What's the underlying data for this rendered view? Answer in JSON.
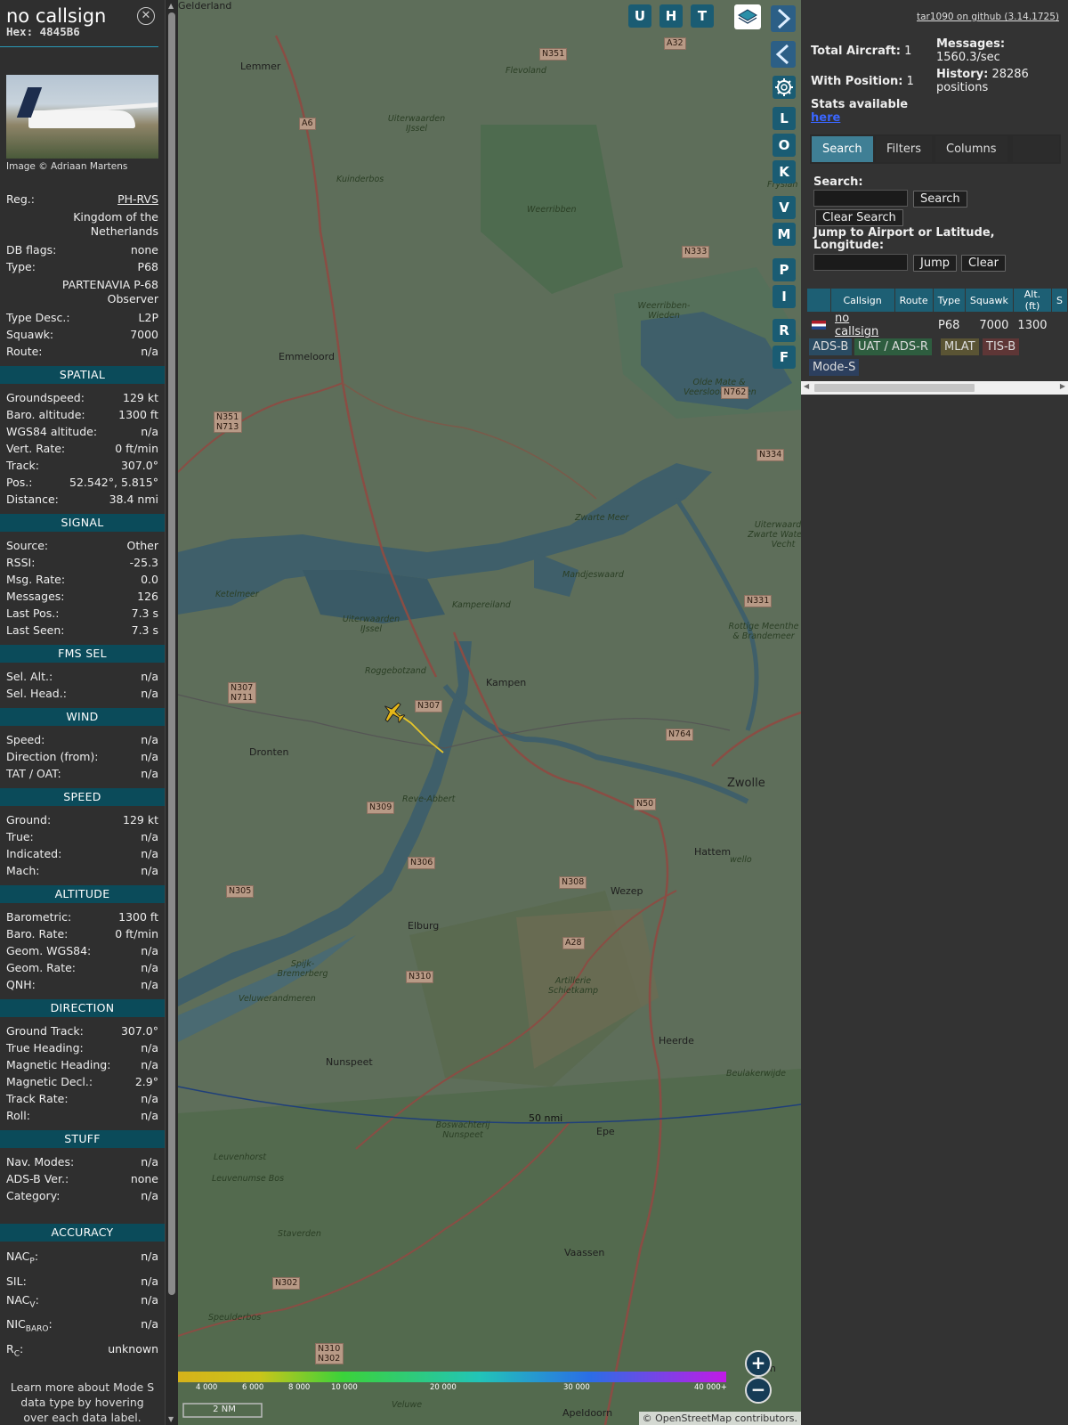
{
  "info": {
    "callsign": "no callsign",
    "hex": "Hex: 4845B6",
    "close_icon": "close-icon",
    "photo_credit": "Image © Adriaan Martens",
    "general": [
      {
        "k": "Reg.:",
        "v": "PH-RVS",
        "link": true
      },
      {
        "k": "",
        "v": "Kingdom of the Netherlands",
        "wrap": true
      },
      {
        "k": "DB flags:",
        "v": "none"
      },
      {
        "k": "Type:",
        "v": "P68"
      },
      {
        "k": "",
        "v": "PARTENAVIA P-68 Observer",
        "wrap": true
      },
      {
        "k": "Type Desc.:",
        "v": "L2P"
      },
      {
        "k": "Squawk:",
        "v": "7000"
      },
      {
        "k": "Route:",
        "v": "n/a"
      }
    ],
    "sections": [
      {
        "title": "SPATIAL",
        "rows": [
          {
            "k": "Groundspeed:",
            "v": "129 kt"
          },
          {
            "k": "Baro. altitude:",
            "v": "1300 ft"
          },
          {
            "k": "WGS84 altitude:",
            "v": "n/a"
          },
          {
            "k": "Vert. Rate:",
            "v": "0 ft/min"
          },
          {
            "k": "Track:",
            "v": "307.0°"
          },
          {
            "k": "Pos.:",
            "v": "52.542°, 5.815°"
          },
          {
            "k": "Distance:",
            "v": "38.4 nmi"
          }
        ]
      },
      {
        "title": "SIGNAL",
        "rows": [
          {
            "k": "Source:",
            "v": "Other"
          },
          {
            "k": "RSSI:",
            "v": "-25.3"
          },
          {
            "k": "Msg. Rate:",
            "v": "0.0"
          },
          {
            "k": "Messages:",
            "v": "126"
          },
          {
            "k": "Last Pos.:",
            "v": "7.3 s"
          },
          {
            "k": "Last Seen:",
            "v": "7.3 s"
          }
        ]
      },
      {
        "title": "FMS SEL",
        "rows": [
          {
            "k": "Sel. Alt.:",
            "v": "n/a"
          },
          {
            "k": "Sel. Head.:",
            "v": "n/a"
          }
        ]
      },
      {
        "title": "WIND",
        "rows": [
          {
            "k": "Speed:",
            "v": "n/a"
          },
          {
            "k": "Direction (from):",
            "v": "n/a"
          },
          {
            "k": "TAT / OAT:",
            "v": "n/a"
          }
        ]
      },
      {
        "title": "SPEED",
        "rows": [
          {
            "k": "Ground:",
            "v": "129 kt"
          },
          {
            "k": "True:",
            "v": "n/a"
          },
          {
            "k": "Indicated:",
            "v": "n/a"
          },
          {
            "k": "Mach:",
            "v": "n/a"
          }
        ]
      },
      {
        "title": "ALTITUDE",
        "rows": [
          {
            "k": "Barometric:",
            "v": "1300 ft"
          },
          {
            "k": "Baro. Rate:",
            "v": "0 ft/min"
          },
          {
            "k": "Geom. WGS84:",
            "v": "n/a"
          },
          {
            "k": "Geom. Rate:",
            "v": "n/a"
          },
          {
            "k": "QNH:",
            "v": "n/a"
          }
        ]
      },
      {
        "title": "DIRECTION",
        "rows": [
          {
            "k": "Ground Track:",
            "v": "307.0°"
          },
          {
            "k": "True Heading:",
            "v": "n/a"
          },
          {
            "k": "Magnetic Heading:",
            "v": "n/a"
          },
          {
            "k": "Magnetic Decl.:",
            "v": "2.9°"
          },
          {
            "k": "Track Rate:",
            "v": "n/a"
          },
          {
            "k": "Roll:",
            "v": "n/a"
          }
        ]
      },
      {
        "title": "STUFF",
        "rows": [
          {
            "k": "Nav. Modes:",
            "v": "n/a"
          },
          {
            "k": "ADS-B Ver.:",
            "v": "none"
          },
          {
            "k": "Category:",
            "v": "n/a"
          }
        ]
      }
    ],
    "accuracy_title": "ACCURACY",
    "accuracy": [
      {
        "k": "NAC",
        "sub": "P",
        "v": "n/a"
      },
      {
        "k": "SIL",
        "sub": "",
        "v": "n/a"
      },
      {
        "k": "NAC",
        "sub": "V",
        "v": "n/a"
      },
      {
        "k": "NIC",
        "sub": "BARO",
        "v": "n/a"
      },
      {
        "k": "R",
        "sub": "C",
        "v": "unknown"
      }
    ],
    "footer": "Learn more about Mode S data type by hovering over each data label."
  },
  "map": {
    "tools_top": [
      "U",
      "H",
      "T"
    ],
    "tools_side": [
      "L",
      "O",
      "K",
      "V",
      "M",
      "P",
      "I",
      "R",
      "F"
    ],
    "layers_icon": "layers-icon",
    "settings_icon": "gear-icon",
    "expand_icon": "chevron-right-icon",
    "collapse_icon": "chevron-left-icon",
    "toggle_icon": "arrows-left-right-icon",
    "zoom_in": "+",
    "zoom_out": "−",
    "range_ring": "50 nmi",
    "scale": "2 NM",
    "altitude_ticks": [
      "4 000",
      "6 000",
      "8 000",
      "10 000",
      "20 000",
      "30 000",
      "40 000+"
    ],
    "attribution": "© OpenStreetMap contributors.",
    "places": [
      "Lemmer",
      "Emmeloord",
      "Dronten",
      "Kampen",
      "Zwolle",
      "Hattem",
      "Wezep",
      "Elburg",
      "Nunspeet",
      "Heerde",
      "Epe",
      "Vaassen",
      "Apeldoorn",
      "Kampereiland",
      "Mandjeswaard",
      "Ketelmeer",
      "Uiterwaarden IJssel",
      "Roggebotzand",
      "Reve-Abbert",
      "Artillerie Schietkamp",
      "Veluwerandmeren",
      "Spijk-Bremerberg",
      "Boswachterij Nunspeet",
      "Leuvenhorst",
      "Leuvenumse Bos",
      "Staverden",
      "Speulderbos",
      "Veluwe",
      "Weerribben",
      "Weerribben-Wieden",
      "Zwarte Meer",
      "Kuinderbos",
      "Flevoland",
      "Rottige Meenthe & Brandemeer",
      "Uiterwaarden Zwarte Water en Vecht",
      "Olde Mate & Veerslootslanden",
      "Beulakerwijde",
      "Uiterwaarden IJssel",
      "Fryslân",
      "Steen",
      "wello",
      "Gelderland"
    ],
    "roads": [
      "N351",
      "A32",
      "A6",
      "N333",
      "N351 N713",
      "N762",
      "N334",
      "N331",
      "N307 N711",
      "N307",
      "N764",
      "N50",
      "N309",
      "N306",
      "N305",
      "N308",
      "A28",
      "N310",
      "N302",
      "N310 N302"
    ]
  },
  "right": {
    "github": "tar1090 on github (3.14.1725)",
    "total_label": "Total Aircraft:",
    "total_value": "1",
    "pos_label": "With Position:",
    "pos_value": "1",
    "messages_label": "Messages:",
    "messages_value": "1560.3/sec",
    "history_label": "History:",
    "history_value": "28286 positions",
    "stats_label": "Stats available",
    "stats_link": "here",
    "tabs": [
      "Search",
      "Filters",
      "Columns"
    ],
    "search_label": "Search:",
    "search_value": "",
    "search_button": "Search",
    "clear_search": "Clear Search",
    "jump_label": "Jump to Airport or Latitude, Longitude:",
    "jump_value": "",
    "jump_button": "Jump",
    "clear_button": "Clear",
    "table_headers": [
      "",
      "Callsign",
      "Route",
      "Type",
      "Squawk",
      "Alt. (ft)",
      "S"
    ],
    "rows": [
      {
        "flag": "nl-flag-icon",
        "callsign": "no callsign",
        "route": "",
        "type": "P68",
        "squawk": "7000",
        "alt": "1300"
      }
    ],
    "sources": [
      {
        "label": "ADS-B",
        "color": "#2a4b62"
      },
      {
        "label": "UAT / ADS-R",
        "color": "#2e5d3f"
      },
      {
        "label": "MLAT",
        "color": "#5a5434"
      },
      {
        "label": "TIS-B",
        "color": "#5e3636"
      },
      {
        "label": "Mode-S",
        "color": "#2c3f5e"
      }
    ]
  }
}
